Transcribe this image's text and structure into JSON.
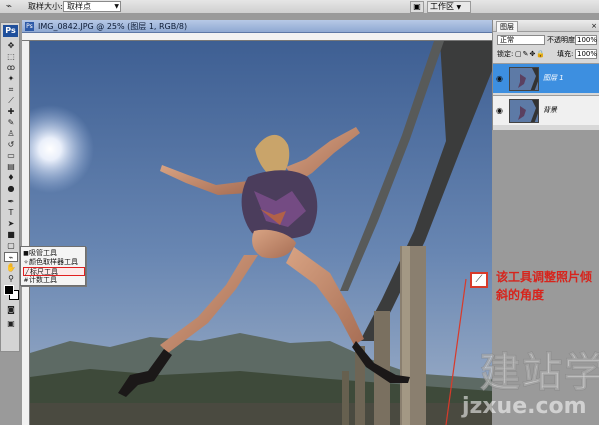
{
  "options_bar": {
    "tool_icon": "eyedropper-icon",
    "sample_size_label": "取样大小:",
    "sample_size_value": "取样点",
    "palette_icon": "palette-well-icon",
    "workspace_label": "工作区"
  },
  "toolbox": {
    "logo": "Ps",
    "tools": [
      "move-icon",
      "marquee-icon",
      "lasso-icon",
      "magic-wand-icon",
      "crop-icon",
      "slice-icon",
      "healing-brush-icon",
      "brush-icon",
      "clone-stamp-icon",
      "history-brush-icon",
      "eraser-icon",
      "gradient-icon",
      "blur-icon",
      "dodge-icon",
      "pen-icon",
      "type-icon",
      "path-selection-icon",
      "shape-icon",
      "notes-icon",
      "eyedropper-icon",
      "hand-icon",
      "zoom-icon"
    ]
  },
  "flyout": {
    "items": [
      {
        "label": "吸管工具",
        "selected": false
      },
      {
        "label": "颜色取样器工具",
        "selected": false
      },
      {
        "label": "标尺工具",
        "selected": true
      },
      {
        "label": "计数工具",
        "selected": false
      }
    ]
  },
  "document": {
    "title": "IMG_0842.JPG @ 25% (图层 1, RGB/8)"
  },
  "annotation": {
    "text": "该工具调整照片倾斜的角度",
    "color": "#d7241c"
  },
  "watermark": {
    "text_cn": "建站学",
    "text_url": "jzxue.com"
  },
  "layers_panel": {
    "tab_label": "图层",
    "close_label": "×",
    "blend_mode": "正常",
    "opacity_label": "不透明度:",
    "opacity_value": "100%",
    "lock_label": "锁定:",
    "fill_label": "填充:",
    "fill_value": "100%",
    "layers": [
      {
        "name": "图层 1",
        "active": true
      },
      {
        "name": "背景",
        "active": false
      }
    ],
    "accent_color": "#3d8fe0"
  }
}
